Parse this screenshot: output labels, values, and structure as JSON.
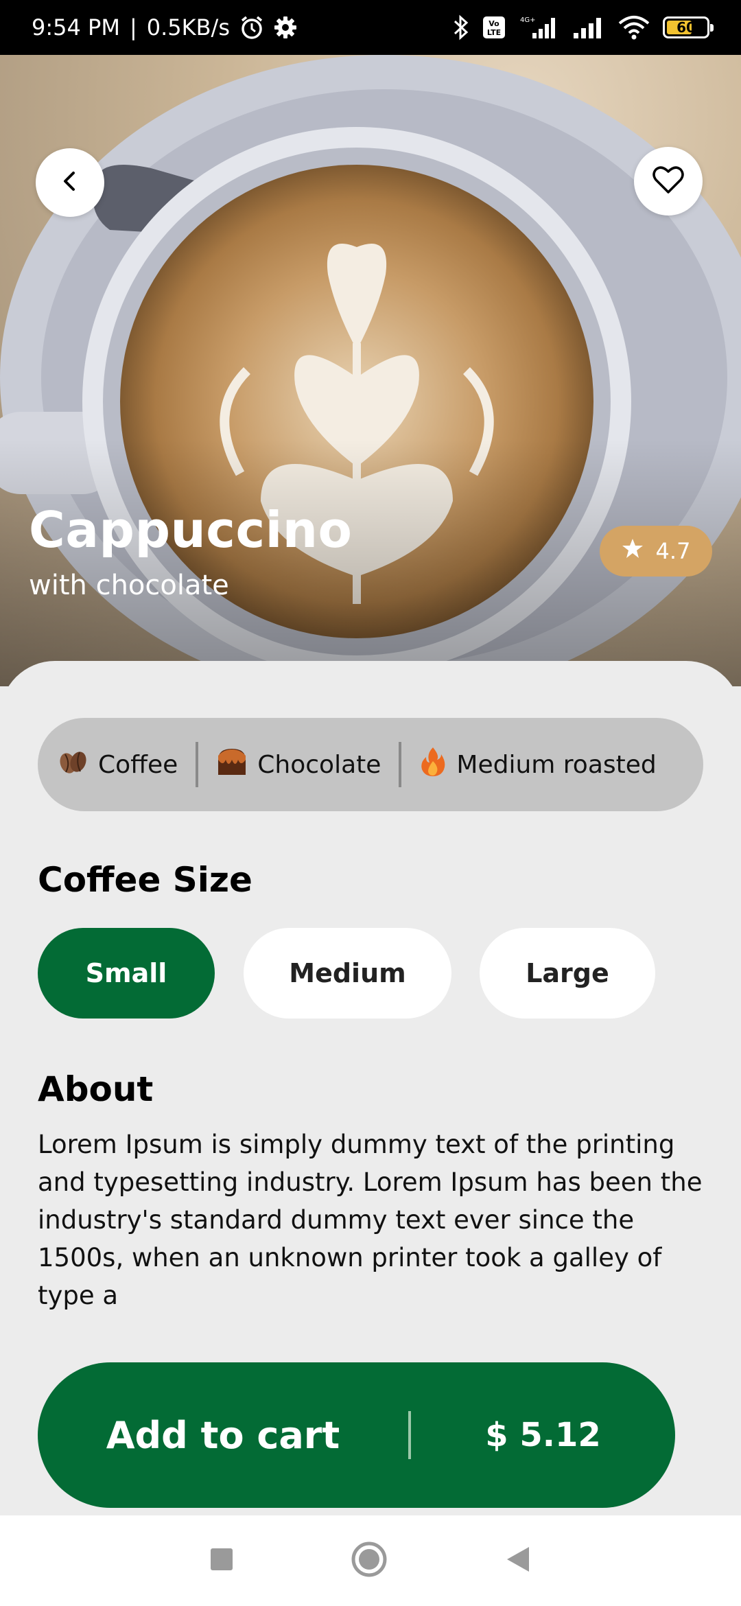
{
  "status_bar": {
    "time": "9:54 PM",
    "separator": "|",
    "network_speed": "0.5KB/s",
    "battery_level": "60",
    "icons": [
      "alarm-icon",
      "settings-icon",
      "bluetooth-icon",
      "volte-icon",
      "signal-icon",
      "signal-icon",
      "wifi-icon",
      "battery-icon"
    ]
  },
  "product": {
    "name": "Cappuccino",
    "subtitle": "with chocolate",
    "rating": "4.7"
  },
  "tags": [
    {
      "label": "Coffee",
      "icon": "coffee-bean-icon"
    },
    {
      "label": "Chocolate",
      "icon": "chocolate-icon"
    },
    {
      "label": "Medium roasted",
      "icon": "fire-icon"
    }
  ],
  "size": {
    "title": "Coffee Size",
    "options": [
      "Small",
      "Medium",
      "Large"
    ],
    "selected": "Small"
  },
  "about": {
    "title": "About",
    "text": "Lorem Ipsum is simply dummy text of the printing and typesetting industry. Lorem Ipsum has been the industry's standard dummy text ever since the 1500s, when an unknown printer took a galley of type a"
  },
  "cart": {
    "label": "Add to cart",
    "price": "$ 5.12"
  },
  "colors": {
    "primary_green": "#036b35",
    "rating_gold": "#d4a464",
    "tag_bg": "#c4c4c4",
    "background": "#ececec"
  }
}
